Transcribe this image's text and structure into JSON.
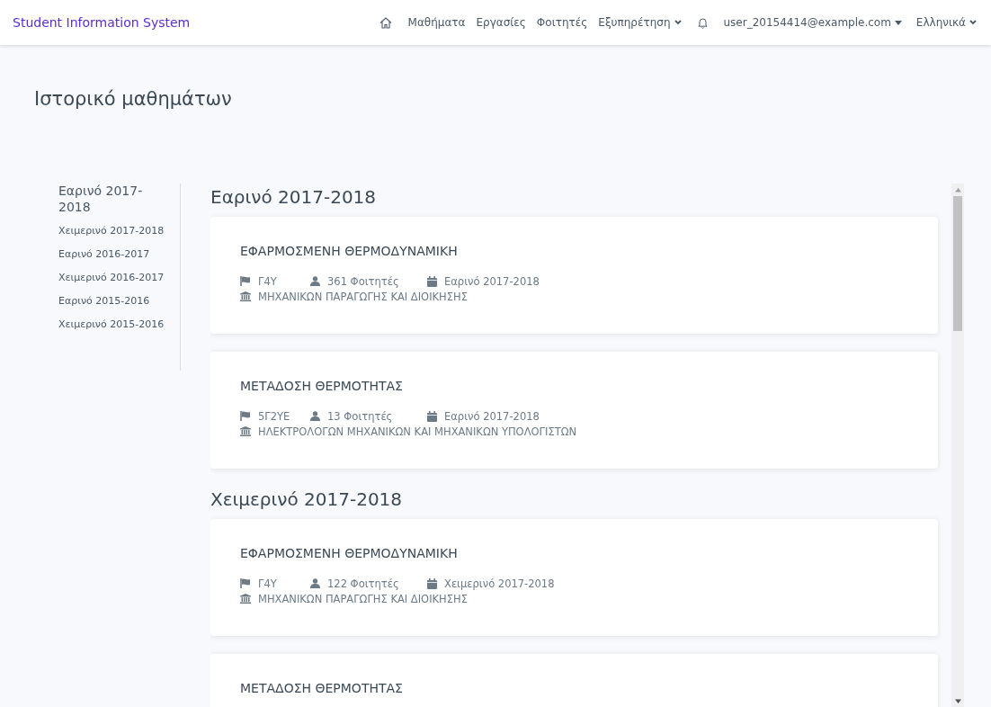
{
  "navbar": {
    "brand_first": "Student",
    "brand_rest": "Information System",
    "links": [
      {
        "label": "Μαθήματα",
        "dropdown": false
      },
      {
        "label": "Εργασίες",
        "dropdown": false
      },
      {
        "label": "Φοιτητές",
        "dropdown": false
      },
      {
        "label": "Εξυπηρέτηση",
        "dropdown": true
      }
    ],
    "user": "user_20154414@example.com",
    "language": "Ελληνικά"
  },
  "page_title": "Ιστορικό μαθημάτων",
  "sidebar": {
    "items": [
      {
        "label": "Εαρινό 2017-2018",
        "selected": true
      },
      {
        "label": "Χειμερινό 2017-2018",
        "selected": false
      },
      {
        "label": "Εαρινό 2016-2017",
        "selected": false
      },
      {
        "label": "Χειμερινό 2016-2017",
        "selected": false
      },
      {
        "label": "Εαρινό 2015-2016",
        "selected": false
      },
      {
        "label": "Χειμερινό 2015-2016",
        "selected": false
      }
    ]
  },
  "semesters": [
    {
      "heading": "Εαρινό 2017-2018",
      "courses": [
        {
          "title": "ΕΦΑΡΜΟΣΜΕΝΗ ΘΕΡΜΟΔΥΝΑΜΙΚΗ",
          "code": "Γ4Υ",
          "students": "361 Φοιτητές",
          "semester": "Εαρινό 2017-2018",
          "department": "ΜΗΧΑΝΙΚΩΝ ΠΑΡΑΓΩΓΗΣ ΚΑΙ ΔΙΟΙΚΗΣΗΣ"
        },
        {
          "title": "ΜΕΤΑΔΟΣΗ ΘΕΡΜΟΤΗΤΑΣ",
          "code": "5Γ2ΥΕ",
          "students": "13 Φοιτητές",
          "semester": "Εαρινό 2017-2018",
          "department": "ΗΛΕΚΤΡΟΛΟΓΩΝ ΜΗΧΑΝΙΚΩΝ ΚΑΙ ΜΗΧΑΝΙΚΩΝ ΥΠΟΛΟΓΙΣΤΩΝ"
        }
      ]
    },
    {
      "heading": "Χειμερινό 2017-2018",
      "courses": [
        {
          "title": "ΕΦΑΡΜΟΣΜΕΝΗ ΘΕΡΜΟΔΥΝΑΜΙΚΗ",
          "code": "Γ4Υ",
          "students": "122 Φοιτητές",
          "semester": "Χειμερινό 2017-2018",
          "department": "ΜΗΧΑΝΙΚΩΝ ΠΑΡΑΓΩΓΗΣ ΚΑΙ ΔΙΟΙΚΗΣΗΣ"
        },
        {
          "title": "ΜΕΤΑΔΟΣΗ ΘΕΡΜΟΤΗΤΑΣ"
        }
      ]
    }
  ]
}
